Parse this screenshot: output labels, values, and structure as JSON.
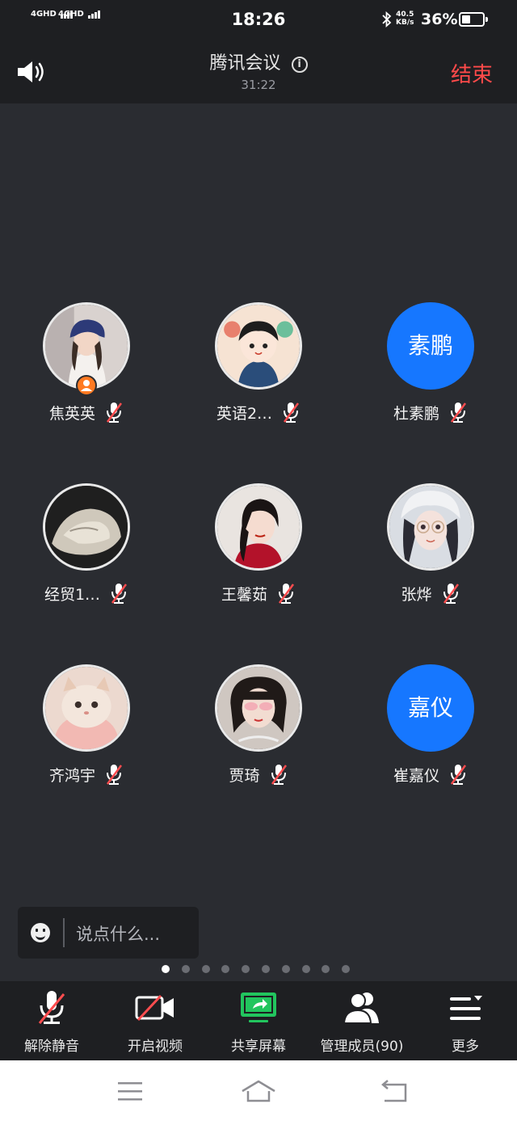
{
  "status_bar": {
    "signal1": "4GHD",
    "signal2": "4GHD",
    "time": "18:26",
    "net_speed": "40.5",
    "net_unit": "KB/s",
    "battery": "36%"
  },
  "header": {
    "title": "腾讯会议",
    "info_glyph": "i",
    "duration": "31:22",
    "end_label": "结束"
  },
  "participants": [
    {
      "name": "焦英英",
      "avatar": "photo",
      "host": true,
      "muted": true
    },
    {
      "name": "英语2…",
      "avatar": "photo",
      "host": false,
      "muted": true
    },
    {
      "name": "杜素鹏",
      "avatar_text": "素鹏",
      "host": false,
      "muted": true
    },
    {
      "name": "经贸1…",
      "avatar": "photo",
      "host": false,
      "muted": true
    },
    {
      "name": "王馨茹",
      "avatar": "photo",
      "host": false,
      "muted": true
    },
    {
      "name": "张烨",
      "avatar": "photo",
      "host": false,
      "muted": true
    },
    {
      "name": "齐鸿宇",
      "avatar": "photo",
      "host": false,
      "muted": true
    },
    {
      "name": "贾琦",
      "avatar": "photo",
      "host": false,
      "muted": true
    },
    {
      "name": "崔嘉仪",
      "avatar_text": "嘉仪",
      "host": false,
      "muted": true
    }
  ],
  "chat": {
    "placeholder": "说点什么..."
  },
  "pager": {
    "total": 10,
    "current": 1
  },
  "toolbar": [
    {
      "label": "解除静音",
      "icon": "mic-muted-icon"
    },
    {
      "label": "开启视频",
      "icon": "video-off-icon"
    },
    {
      "label": "共享屏幕",
      "icon": "share-screen-icon"
    },
    {
      "label": "管理成员(90)",
      "icon": "members-icon"
    },
    {
      "label": "更多",
      "icon": "more-menu-icon"
    }
  ],
  "colors": {
    "background": "#2a2c31",
    "bar": "#1e1f22",
    "accent_blue": "#1677ff",
    "end_red": "#ff4a4a",
    "muted_red": "#ff4d4f",
    "share_green": "#22c55e",
    "host_orange": "#ff7a22"
  }
}
